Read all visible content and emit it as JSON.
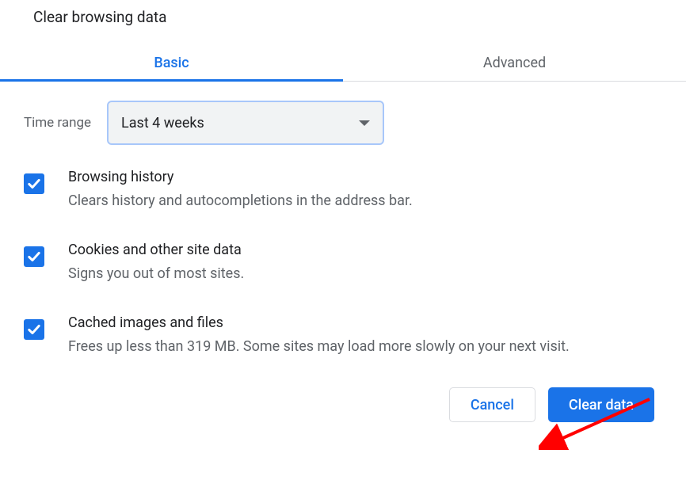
{
  "dialog": {
    "title": "Clear browsing data"
  },
  "tabs": {
    "basic": "Basic",
    "advanced": "Advanced"
  },
  "timeRange": {
    "label": "Time range",
    "value": "Last 4 weeks"
  },
  "options": {
    "history": {
      "title": "Browsing history",
      "desc": "Clears history and autocompletions in the address bar.",
      "checked": true
    },
    "cookies": {
      "title": "Cookies and other site data",
      "desc": "Signs you out of most sites.",
      "checked": true
    },
    "cache": {
      "title": "Cached images and files",
      "desc": "Frees up less than 319 MB. Some sites may load more slowly on your next visit.",
      "checked": true
    }
  },
  "buttons": {
    "cancel": "Cancel",
    "clear": "Clear data"
  },
  "colors": {
    "accent": "#1a73e8"
  }
}
